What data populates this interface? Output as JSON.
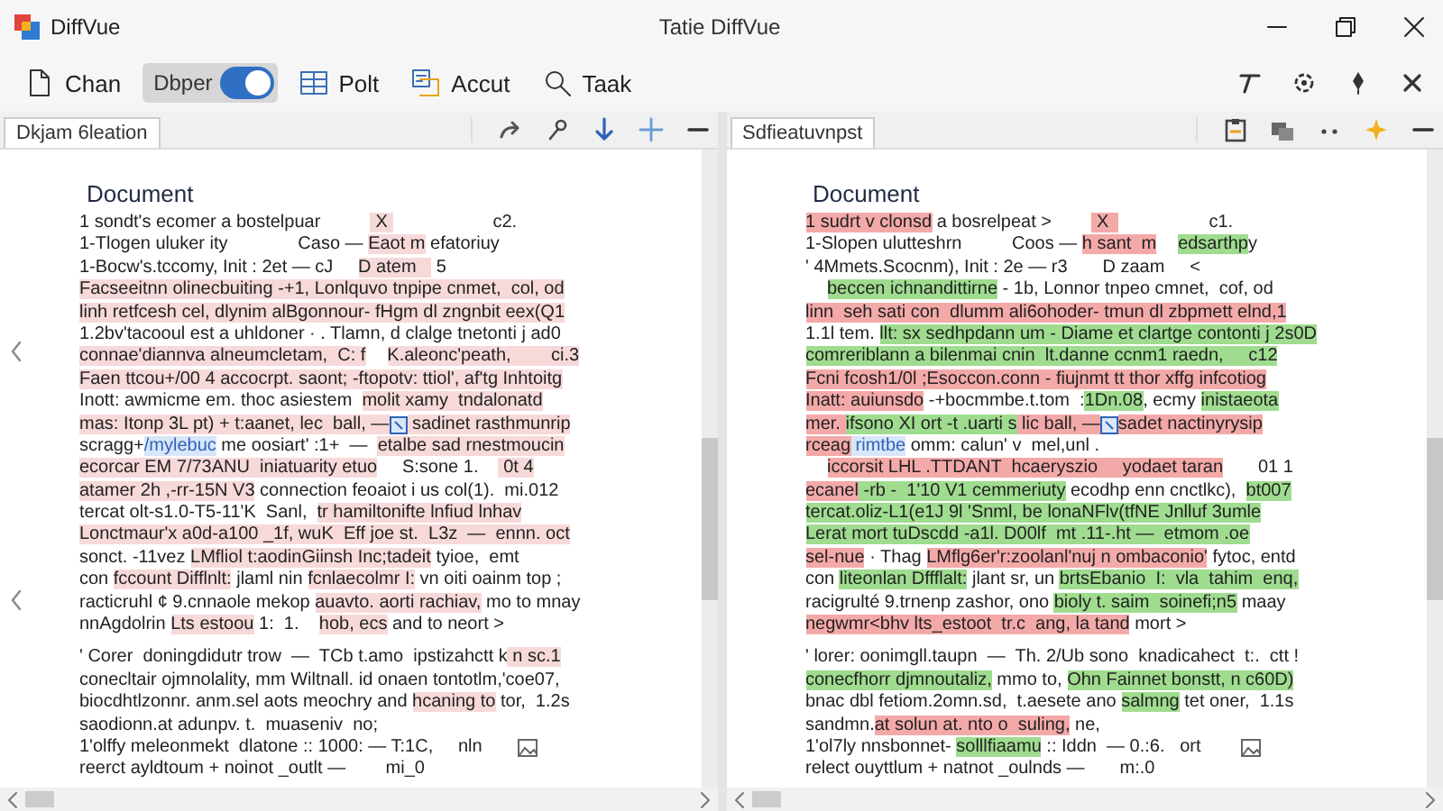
{
  "window": {
    "app_name": "DiffVue",
    "title": "Tatie DiffVue"
  },
  "toolbar": [
    {
      "kind": "button",
      "label": "Chan"
    },
    {
      "kind": "toggle",
      "label": "Dbper",
      "on": true
    },
    {
      "kind": "button",
      "label": "Polt"
    },
    {
      "kind": "button",
      "label": "Accut"
    },
    {
      "kind": "button",
      "label": "Taak"
    }
  ],
  "panes": [
    {
      "tab": "Dkjam 6leation",
      "heading": "Document",
      "lines": [
        {
          "kind": "line",
          "segments": [
            {
              "kind": "plain",
              "text": "1 sondt's ecomer a bostelpuar          "
            },
            {
              "kind": "deleted",
              "text": " X "
            },
            {
              "kind": "plain",
              "text": "                    c2."
            }
          ]
        },
        {
          "kind": "line",
          "segments": [
            {
              "kind": "plain",
              "text": "1-Tlogen uluker ity              Caso — "
            },
            {
              "kind": "deleted",
              "text": "Eaot m"
            },
            {
              "kind": "plain",
              "text": " efatoriuy"
            }
          ]
        },
        {
          "kind": "line",
          "segments": [
            {
              "kind": "plain",
              "text": "1-Bocw's.tccomy, Init : 2et — cJ     "
            },
            {
              "kind": "deleted",
              "text": "D atem   "
            },
            {
              "kind": "plain",
              "text": " 5"
            }
          ]
        },
        {
          "kind": "line",
          "segments": [
            {
              "kind": "deleted",
              "text": "Facseeitnn olinecbuiting -+1, Lonlquvo tnpipe cnmet,  col, od"
            }
          ]
        },
        {
          "kind": "line",
          "segments": [
            {
              "kind": "deleted",
              "text": "linh retfcesh cel, dlynim alBgonnour- fHgm dl zngnbit eex(Q1"
            }
          ]
        },
        {
          "kind": "line",
          "segments": [
            {
              "kind": "plain",
              "text": "1.2bv'tacooul est a uhldoner · . Tlamn, d clalge tnetonti j ad0"
            }
          ]
        },
        {
          "kind": "line",
          "segments": [
            {
              "kind": "deleted",
              "text": "connae'diannva alneumcletam,  C: f"
            },
            {
              "kind": "space"
            },
            {
              "kind": "deleted",
              "text": "K.aleonc'peath,        ci.3"
            }
          ]
        },
        {
          "kind": "line",
          "segments": [
            {
              "kind": "deleted",
              "text": "Faen ttcou+/00 4 accocrpt. saont; -ftopotv: ttiol', af'tg Inhtoitg"
            }
          ]
        },
        {
          "kind": "line",
          "segments": [
            {
              "kind": "plain",
              "text": "Inott: awmicme em. thoc asiestem  "
            },
            {
              "kind": "deleted",
              "text": "molit xamy  tndalonatd"
            }
          ]
        },
        {
          "kind": "line",
          "segments": [
            {
              "kind": "deleted",
              "text": "mas: Itonp 3L pt) + t:aanet, lec  ball, —"
            },
            {
              "kind": "cursor"
            },
            {
              "kind": "deleted",
              "text": " sadinet rasthmunrip"
            }
          ]
        },
        {
          "kind": "line",
          "segments": [
            {
              "kind": "plain",
              "text": "scragg+"
            },
            {
              "kind": "marked",
              "text": "/mylebuc"
            },
            {
              "kind": "plain",
              "text": " me oosiart' :1+  —  "
            },
            {
              "kind": "deleted",
              "text": "etalbe sad rnestmoucin"
            }
          ]
        },
        {
          "kind": "line",
          "segments": [
            {
              "kind": "deleted",
              "text": "ecorcar EM 7/73ANU  iniatuarity etuo"
            },
            {
              "kind": "plain",
              "text": "     S:sone 1.    "
            },
            {
              "kind": "deleted",
              "text": " 0t 4"
            }
          ]
        },
        {
          "kind": "line",
          "segments": [
            {
              "kind": "deleted",
              "text": "atamer 2h ,-rr-15N V3"
            },
            {
              "kind": "plain",
              "text": " connection feoaiot i us col(1).  mi.012"
            }
          ]
        },
        {
          "kind": "line",
          "segments": [
            {
              "kind": "plain",
              "text": "tercat olt-s1.0-T5-11'K  Sanl,  "
            },
            {
              "kind": "deleted",
              "text": "tr hamiltonifte lnfiud lnhav"
            }
          ]
        },
        {
          "kind": "line",
          "segments": [
            {
              "kind": "deleted",
              "text": "Lonctmaur'x a0d-a100 _1f, wuK  Eff joe st.  L3z  —  ennn. oct"
            }
          ]
        },
        {
          "kind": "line",
          "segments": [
            {
              "kind": "plain",
              "text": "sonct. -11vez "
            },
            {
              "kind": "deleted",
              "text": "LMfliol t:aodinGiinsh Inc;tadeit"
            },
            {
              "kind": "plain",
              "text": " tyioe,  emt"
            }
          ]
        },
        {
          "kind": "line",
          "segments": [
            {
              "kind": "plain",
              "text": "con "
            },
            {
              "kind": "deleted",
              "text": "fccount Difflnlt:"
            },
            {
              "kind": "plain",
              "text": " jlaml nin "
            },
            {
              "kind": "deleted",
              "text": "fcnlaecolmr I:"
            },
            {
              "kind": "plain",
              "text": " vn oiti oainm top ;"
            }
          ]
        },
        {
          "kind": "line",
          "segments": [
            {
              "kind": "plain",
              "text": "racticruhl ¢ 9.cnnaole mekop "
            },
            {
              "kind": "deleted",
              "text": "auavto. aorti rachiav,"
            },
            {
              "kind": "plain",
              "text": " mo to mnay"
            }
          ]
        },
        {
          "kind": "line",
          "segments": [
            {
              "kind": "plain",
              "text": "nnAgdolrin "
            },
            {
              "kind": "deleted",
              "text": "Lts estoou"
            },
            {
              "kind": "plain",
              "text": " 1:  1.    "
            },
            {
              "kind": "deleted",
              "text": "hob, ecs"
            },
            {
              "kind": "plain",
              "text": " and to neort >"
            }
          ]
        },
        {
          "kind": "gap"
        },
        {
          "kind": "line",
          "segments": [
            {
              "kind": "plain",
              "text": "' Corer  doningdidutr trow  —  TCb t.amo  ipstizahctt k"
            },
            {
              "kind": "deleted",
              "text": " n sc.1"
            }
          ]
        },
        {
          "kind": "line",
          "segments": [
            {
              "kind": "plain",
              "text": "conecltair ojmnolality, mm Wiltnall. id onaen tontotlm,'coe07,"
            }
          ]
        },
        {
          "kind": "line",
          "segments": [
            {
              "kind": "plain",
              "text": "biocdhtlzonnr. anm.sel aots meochry and "
            },
            {
              "kind": "deleted",
              "text": "hcaning to"
            },
            {
              "kind": "plain",
              "text": " tor,  1.2s"
            }
          ]
        },
        {
          "kind": "line",
          "segments": [
            {
              "kind": "plain",
              "text": "saodionn.at adunpv. t.  muaseniv  no;"
            }
          ]
        },
        {
          "kind": "line",
          "segments": [
            {
              "kind": "plain",
              "text": "1'olffy meleonmekt  dlatone :: 1000: — T:1C,     nln       "
            },
            {
              "kind": "image"
            }
          ]
        },
        {
          "kind": "line",
          "segments": [
            {
              "kind": "plain",
              "text": "reerct ayldtoum + noinot _outlt —        mi_0"
            }
          ]
        }
      ]
    },
    {
      "tab": "Sdfieatuvnpst",
      "heading": "Document",
      "lines": [
        {
          "kind": "line",
          "segments": [
            {
              "kind": "deleted",
              "text": "1 sudrt v clonsd"
            },
            {
              "kind": "plain",
              "text": " a bosrelpeat >        "
            },
            {
              "kind": "deleted",
              "text": " X  "
            },
            {
              "kind": "plain",
              "text": "                  c1."
            }
          ]
        },
        {
          "kind": "line",
          "segments": [
            {
              "kind": "plain",
              "text": "1-Slopen ulutteshrn          Coos — "
            },
            {
              "kind": "deleted",
              "text": "h sant  m"
            },
            {
              "kind": "space"
            },
            {
              "kind": "inserted",
              "text": "edsarthp"
            },
            {
              "kind": "plain",
              "text": "y"
            }
          ]
        },
        {
          "kind": "line",
          "segments": [
            {
              "kind": "plain",
              "text": "' 4Mmets.Scocnm), Init : 2e — r3       D zaam     <"
            }
          ]
        },
        {
          "kind": "line",
          "segments": [
            {
              "kind": "space"
            },
            {
              "kind": "inserted",
              "text": "beccen ichnandittirne"
            },
            {
              "kind": "plain",
              "text": " - 1b, Lonnor tnpeo cmnet,  cof, od"
            }
          ]
        },
        {
          "kind": "line",
          "segments": [
            {
              "kind": "deleted",
              "text": "linn  seh sati con  dlumm ali6ohoder- tmun dl zbpmett elnd,1"
            }
          ]
        },
        {
          "kind": "line",
          "segments": [
            {
              "kind": "plain",
              "text": "1.1l tem. "
            },
            {
              "kind": "inserted",
              "text": "llt: sx sedhpdann um - Diame et clartge contonti j 2s0D"
            }
          ]
        },
        {
          "kind": "line",
          "segments": [
            {
              "kind": "inserted",
              "text": "comreriblann a bilenmai cnin  lt.danne ccnm1 raedn,     c12"
            }
          ]
        },
        {
          "kind": "line",
          "segments": [
            {
              "kind": "deleted",
              "text": "Fcni fcosh1/0l ;Esoccon.conn - fiujnmt tt thor xffg infcotiog"
            }
          ]
        },
        {
          "kind": "line",
          "segments": [
            {
              "kind": "deleted",
              "text": "Inatt: auiunsdo"
            },
            {
              "kind": "plain",
              "text": " -+bocmmbe.t.tom  :"
            },
            {
              "kind": "inserted",
              "text": "1Dn.08"
            },
            {
              "kind": "plain",
              "text": ", ecmy "
            },
            {
              "kind": "inserted",
              "text": "inistaeota"
            }
          ]
        },
        {
          "kind": "line",
          "segments": [
            {
              "kind": "deleted",
              "text": "mer. "
            },
            {
              "kind": "inserted",
              "text": "ifsono XI ort -t .uarti s"
            },
            {
              "kind": "deleted",
              "text": " lic ball, —"
            },
            {
              "kind": "cursor"
            },
            {
              "kind": "deleted",
              "text": "sadet nactinyrysip"
            }
          ]
        },
        {
          "kind": "line",
          "segments": [
            {
              "kind": "deleted",
              "text": "rceag"
            },
            {
              "kind": "marked",
              "text": " rimtbe"
            },
            {
              "kind": "plain",
              "text": " omm: calun' v  mel,unl ."
            }
          ]
        },
        {
          "kind": "line",
          "segments": [
            {
              "kind": "space"
            },
            {
              "kind": "deleted",
              "text": "iccorsit LHL .TTDANT  hcaeryszio     yodaet taran"
            },
            {
              "kind": "plain",
              "text": "       01 1"
            }
          ]
        },
        {
          "kind": "line",
          "segments": [
            {
              "kind": "deleted",
              "text": "ecanel"
            },
            {
              "kind": "inserted",
              "text": " -rb -  1'10 V1 cemmeriuty"
            },
            {
              "kind": "plain",
              "text": " ecodhp enn cnctlkc),  "
            },
            {
              "kind": "inserted",
              "text": "bt007"
            }
          ]
        },
        {
          "kind": "line",
          "segments": [
            {
              "kind": "inserted",
              "text": "tercat.oliz-L1(e1J 9l 'Snml, be lonaNFlv(tfNE Jnlluf 3umle"
            }
          ]
        },
        {
          "kind": "line",
          "segments": [
            {
              "kind": "inserted",
              "text": "Lerat mort tuDscdd -a1l. D00lf  mt .11-.ht —  etmom .oe"
            }
          ]
        },
        {
          "kind": "line",
          "segments": [
            {
              "kind": "deleted",
              "text": "sel-nue"
            },
            {
              "kind": "plain",
              "text": " · Thag "
            },
            {
              "kind": "deleted",
              "text": "LMflg6er'r:zoolanl'nuj n ombaconio'"
            },
            {
              "kind": "plain",
              "text": " fytoc, entd"
            }
          ]
        },
        {
          "kind": "line",
          "segments": [
            {
              "kind": "plain",
              "text": "con "
            },
            {
              "kind": "inserted",
              "text": "liteonlan Dffflalt:"
            },
            {
              "kind": "plain",
              "text": " jlant sr, un "
            },
            {
              "kind": "inserted",
              "text": "brtsEbanio  I:  vla  tahim  enq,"
            }
          ]
        },
        {
          "kind": "line",
          "segments": [
            {
              "kind": "plain",
              "text": "racigrulté 9.trnenp zashor, ono "
            },
            {
              "kind": "inserted",
              "text": "bioly t. saim  soinefi;n5"
            },
            {
              "kind": "plain",
              "text": " maay"
            }
          ]
        },
        {
          "kind": "line",
          "segments": [
            {
              "kind": "deleted",
              "text": "negwmr<bhv lts_estoot  tr.c  ang, la tand"
            },
            {
              "kind": "plain",
              "text": " mort >"
            }
          ]
        },
        {
          "kind": "gap"
        },
        {
          "kind": "line",
          "segments": [
            {
              "kind": "plain",
              "text": "' lorer: oonimgll.taupn  —  Th. 2/Ub sono  knadicahect  t:.  ctt !"
            }
          ]
        },
        {
          "kind": "line",
          "segments": [
            {
              "kind": "inserted",
              "text": "conecfhorr djmnoutaliz,"
            },
            {
              "kind": "plain",
              "text": " mmo to, "
            },
            {
              "kind": "inserted",
              "text": "Ohn Fainnet bonstt, n c60D)"
            }
          ]
        },
        {
          "kind": "line",
          "segments": [
            {
              "kind": "plain",
              "text": "bnac dbl fetiom.2omn.sd,  t.aesete ano "
            },
            {
              "kind": "inserted",
              "text": "salmng"
            },
            {
              "kind": "plain",
              "text": " tet oner,  1.1s"
            }
          ]
        },
        {
          "kind": "line",
          "segments": [
            {
              "kind": "plain",
              "text": "sandmn."
            },
            {
              "kind": "deleted",
              "text": "at solun at. nto o  suling,"
            },
            {
              "kind": "plain",
              "text": " ne,"
            }
          ]
        },
        {
          "kind": "line",
          "segments": [
            {
              "kind": "plain",
              "text": "1'ol7ly nnsbonnet- "
            },
            {
              "kind": "inserted",
              "text": "solllfiaamu"
            },
            {
              "kind": "plain",
              "text": " :: Iddn  — 0.:6.   ort        "
            },
            {
              "kind": "image"
            }
          ]
        },
        {
          "kind": "line",
          "segments": [
            {
              "kind": "plain",
              "text": "relect ouyttlum + natnot _oulnds —       m:.0"
            }
          ]
        }
      ]
    }
  ]
}
